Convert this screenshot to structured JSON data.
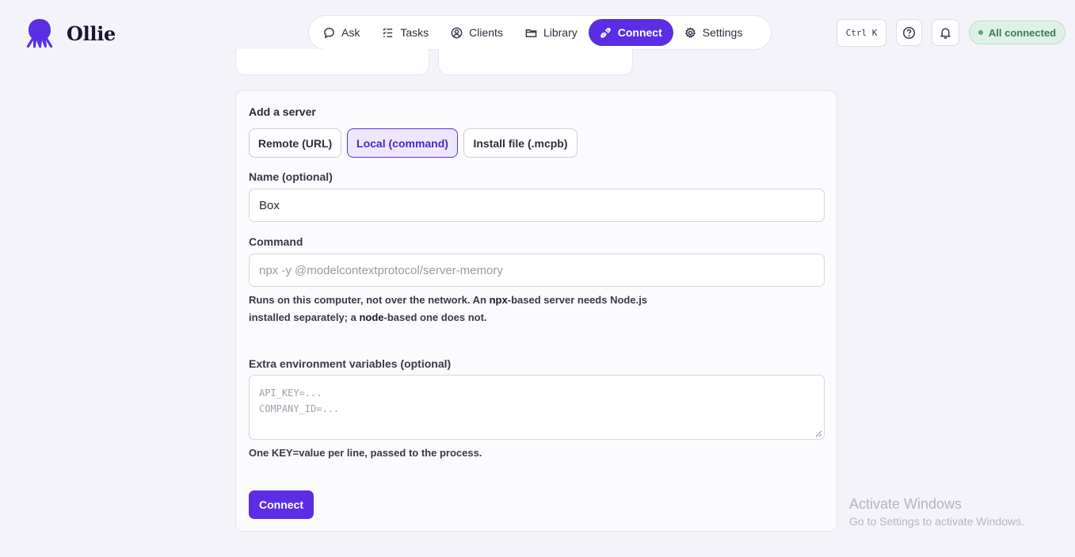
{
  "app": {
    "name": "Ollie"
  },
  "nav": [
    {
      "label": "Ask",
      "icon": "chat-bubble-icon"
    },
    {
      "label": "Tasks",
      "icon": "checklist-icon"
    },
    {
      "label": "Clients",
      "icon": "user-circle-icon"
    },
    {
      "label": "Library",
      "icon": "folder-icon"
    },
    {
      "label": "Connect",
      "icon": "plug-icon",
      "active": true
    },
    {
      "label": "Settings",
      "icon": "gear-icon"
    }
  ],
  "header": {
    "shortcut": "Ctrl K",
    "help_icon": "question-circle-icon",
    "notifications_icon": "bell-icon",
    "status": "All connected"
  },
  "form": {
    "title": "Add a server",
    "tabs": [
      {
        "label": "Remote (URL)"
      },
      {
        "label": "Local (command)",
        "active": true
      },
      {
        "label": "Install file (.mcpb)"
      }
    ],
    "name_label": "Name (optional)",
    "name_value": "Box",
    "command_label": "Command",
    "command_placeholder": "npx -y @modelcontextprotocol/server-memory",
    "command_help": {
      "part1": "Runs on this computer, not over the network. An ",
      "npx": "npx",
      "part2": "-based server needs Node.js",
      "part3": "installed separately; a ",
      "node": "node",
      "part4": "-based one does not."
    },
    "env_label": "Extra environment variables (optional)",
    "env_placeholder_line1": "API_KEY=...",
    "env_placeholder_line2": "COMPANY_ID=...",
    "env_help": "One KEY=value per line, passed to the process.",
    "submit_label": "Connect"
  },
  "watermark": {
    "title": "Activate Windows",
    "subtitle": "Go to Settings to activate Windows."
  },
  "colors": {
    "accent": "#5b2ee6",
    "background": "#f4f3f9",
    "status_bg": "#dff1e6",
    "status_text": "#3d7a57"
  }
}
